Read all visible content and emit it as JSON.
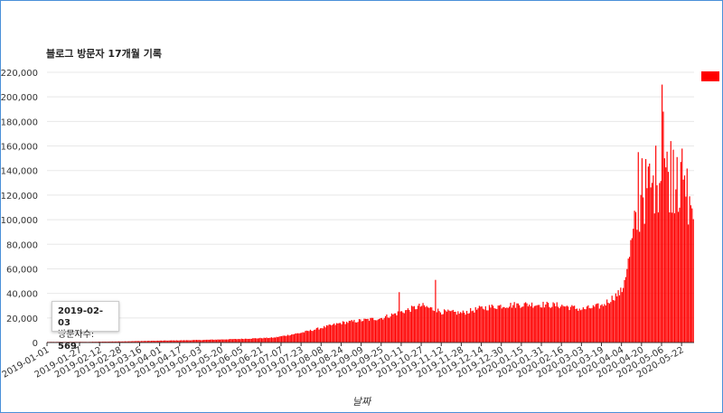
{
  "colors": {
    "bar": "#ff0000",
    "grid": "#e8e8e8",
    "axis": "#333333",
    "border": "#4a90d9"
  },
  "chart_data": {
    "type": "bar",
    "title": "블로그 방문자 17개월 기록",
    "xlabel": "날짜",
    "ylabel": "",
    "ylim": [
      0,
      220000
    ],
    "yticks": [
      "0",
      "20,000",
      "40,000",
      "60,000",
      "80,000",
      "100,000",
      "120,000",
      "140,000",
      "160,000",
      "180,000",
      "200,000",
      "220,000"
    ],
    "ytick_values": [
      0,
      20000,
      40000,
      60000,
      80000,
      100000,
      120000,
      140000,
      160000,
      180000,
      200000,
      220000
    ],
    "x_range": [
      "2019-01-01",
      "2020-05-31"
    ],
    "xticks": [
      "2019-01-01",
      "2019-01-27",
      "2019-02-12",
      "2019-02-28",
      "2019-03-16",
      "2019-04-01",
      "2019-04-17",
      "2019-05-03",
      "2019-05-20",
      "2019-06-05",
      "2019-06-21",
      "2019-07-07",
      "2019-07-23",
      "2019-08-08",
      "2019-08-24",
      "2019-09-09",
      "2019-09-25",
      "2019-10-11",
      "2019-10-27",
      "2019-11-12",
      "2019-11-28",
      "2019-12-14",
      "2019-12-30",
      "2020-01-15",
      "2020-01-31",
      "2020-02-16",
      "2020-03-03",
      "2020-03-19",
      "2020-04-04",
      "2020-04-20",
      "2020-05-06",
      "2020-05-22"
    ],
    "anchors": [
      [
        "2019-01-01",
        500
      ],
      [
        "2019-02-03",
        569
      ],
      [
        "2019-03-01",
        900
      ],
      [
        "2019-04-01",
        1500
      ],
      [
        "2019-05-01",
        2000
      ],
      [
        "2019-06-01",
        2800
      ],
      [
        "2019-07-01",
        4000
      ],
      [
        "2019-07-23",
        8000
      ],
      [
        "2019-08-08",
        12000
      ],
      [
        "2019-08-24",
        16000
      ],
      [
        "2019-09-09",
        18000
      ],
      [
        "2019-09-25",
        20000
      ],
      [
        "2019-10-11",
        25000
      ],
      [
        "2019-10-27",
        30000
      ],
      [
        "2019-11-12",
        25000
      ],
      [
        "2019-11-28",
        24000
      ],
      [
        "2019-12-14",
        28000
      ],
      [
        "2019-12-30",
        30000
      ],
      [
        "2020-01-15",
        31000
      ],
      [
        "2020-01-31",
        31000
      ],
      [
        "2020-02-16",
        30000
      ],
      [
        "2020-03-03",
        27000
      ],
      [
        "2020-03-19",
        30000
      ],
      [
        "2020-04-04",
        42000
      ],
      [
        "2020-04-12",
        80000
      ],
      [
        "2020-04-20",
        120000
      ],
      [
        "2020-05-06",
        140000
      ],
      [
        "2020-05-22",
        130000
      ],
      [
        "2020-05-31",
        110000
      ]
    ],
    "peaks": [
      [
        "2019-10-09",
        41000
      ],
      [
        "2019-11-07",
        51000
      ],
      [
        "2020-04-12",
        85000
      ],
      [
        "2020-04-17",
        155000
      ],
      [
        "2020-04-20",
        150000
      ],
      [
        "2020-04-28",
        130000
      ],
      [
        "2020-05-02",
        128000
      ],
      [
        "2020-05-06",
        210000
      ],
      [
        "2020-05-07",
        188000
      ],
      [
        "2020-05-08",
        150000
      ],
      [
        "2020-05-13",
        164000
      ],
      [
        "2020-05-15",
        157000
      ],
      [
        "2020-05-18",
        151000
      ],
      [
        "2020-05-21",
        147000
      ],
      [
        "2020-05-24",
        136000
      ],
      [
        "2020-05-28",
        119000
      ]
    ],
    "series": [
      {
        "name": "방문자수"
      }
    ]
  },
  "tooltip": {
    "date": "2019-02-03",
    "label": "방문자수: ",
    "value": "569"
  }
}
